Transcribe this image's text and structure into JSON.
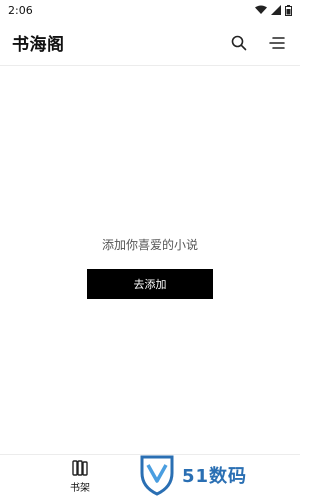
{
  "status_bar": {
    "time": "2:06"
  },
  "app_bar": {
    "title": "书海阁"
  },
  "empty_state": {
    "message": "添加你喜爱的小说",
    "button_label": "去添加"
  },
  "bottom_nav": {
    "items": [
      {
        "label": "书架",
        "icon": "bookshelf-icon"
      }
    ]
  },
  "watermark": {
    "text": "51数码",
    "color": "#2a6fb3"
  }
}
